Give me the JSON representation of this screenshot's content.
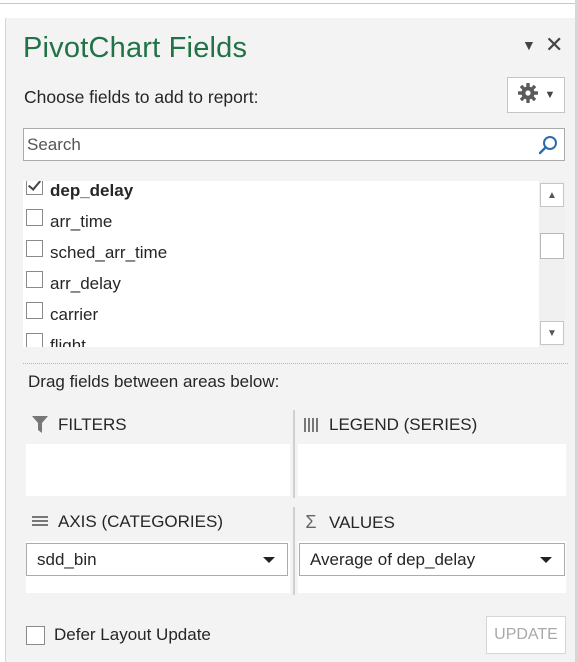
{
  "panel": {
    "title": "PivotChart Fields",
    "choose_label": "Choose fields to add to report:"
  },
  "search": {
    "placeholder": "Search"
  },
  "fields": [
    {
      "label": "dep_delay",
      "checked": true
    },
    {
      "label": "arr_time",
      "checked": false
    },
    {
      "label": "sched_arr_time",
      "checked": false
    },
    {
      "label": "arr_delay",
      "checked": false
    },
    {
      "label": "carrier",
      "checked": false
    },
    {
      "label": "flight",
      "checked": false
    }
  ],
  "areas": {
    "drag_label": "Drag fields between areas below:",
    "filters": {
      "label": "FILTERS"
    },
    "legend": {
      "label": "LEGEND (SERIES)"
    },
    "axis": {
      "label": "AXIS (CATEGORIES)",
      "items": [
        "sdd_bin"
      ]
    },
    "values": {
      "label": "VALUES",
      "items": [
        "Average of dep_delay"
      ]
    }
  },
  "footer": {
    "defer_label": "Defer Layout Update",
    "update_label": "UPDATE"
  },
  "colors": {
    "title_green": "#217346",
    "panel_bg": "#f3f3f3"
  },
  "icons": {
    "dropdown": "caret-down-icon",
    "close": "close-icon",
    "settings": "gear-icon",
    "search": "search-icon",
    "filter": "filter-icon",
    "legend": "columns-icon",
    "axis": "rows-icon",
    "values": "sigma-icon"
  }
}
